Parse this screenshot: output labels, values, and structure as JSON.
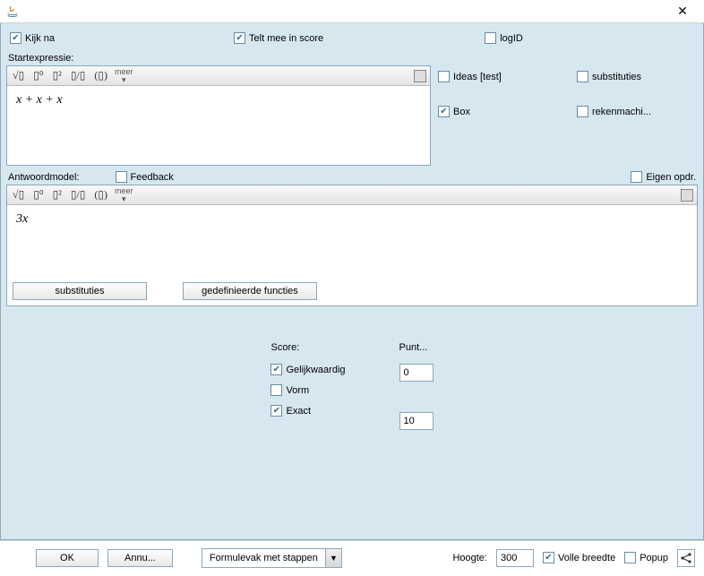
{
  "titlebar": {
    "close": "✕"
  },
  "top": {
    "kijkna": "Kijk na",
    "teltmee": "Telt mee in score",
    "logid": "logID"
  },
  "start": {
    "label": "Startexpressie:",
    "toolbar": {
      "sqrt": "√▯",
      "sup0": "▯⁰",
      "sup2": "▯²",
      "frac": "▯/▯",
      "paren": "(▯)",
      "meer": "meer"
    },
    "content": "x + x + x"
  },
  "right": {
    "ideas": "Ideas [test]",
    "substituties": "substituties",
    "box": "Box",
    "reken": "rekenmachi..."
  },
  "answer": {
    "label": "Antwoordmodel:",
    "feedback": "Feedback",
    "eigen": "Eigen opdr.",
    "content": "3x",
    "btn_sub": "substituties",
    "btn_def": "gedefinieerde functies"
  },
  "score": {
    "hdr": "Score:",
    "gelijk": "Gelijkwaardig",
    "vorm": "Vorm",
    "exact": "Exact",
    "punt_hdr": "Punt...",
    "p0": "0",
    "p10": "10"
  },
  "bottom": {
    "ok": "OK",
    "annu": "Annu...",
    "select": "Formulevak met stappen",
    "hoogte_lbl": "Hoogte:",
    "hoogte_val": "300",
    "volle": "Volle breedte",
    "popup": "Popup"
  }
}
